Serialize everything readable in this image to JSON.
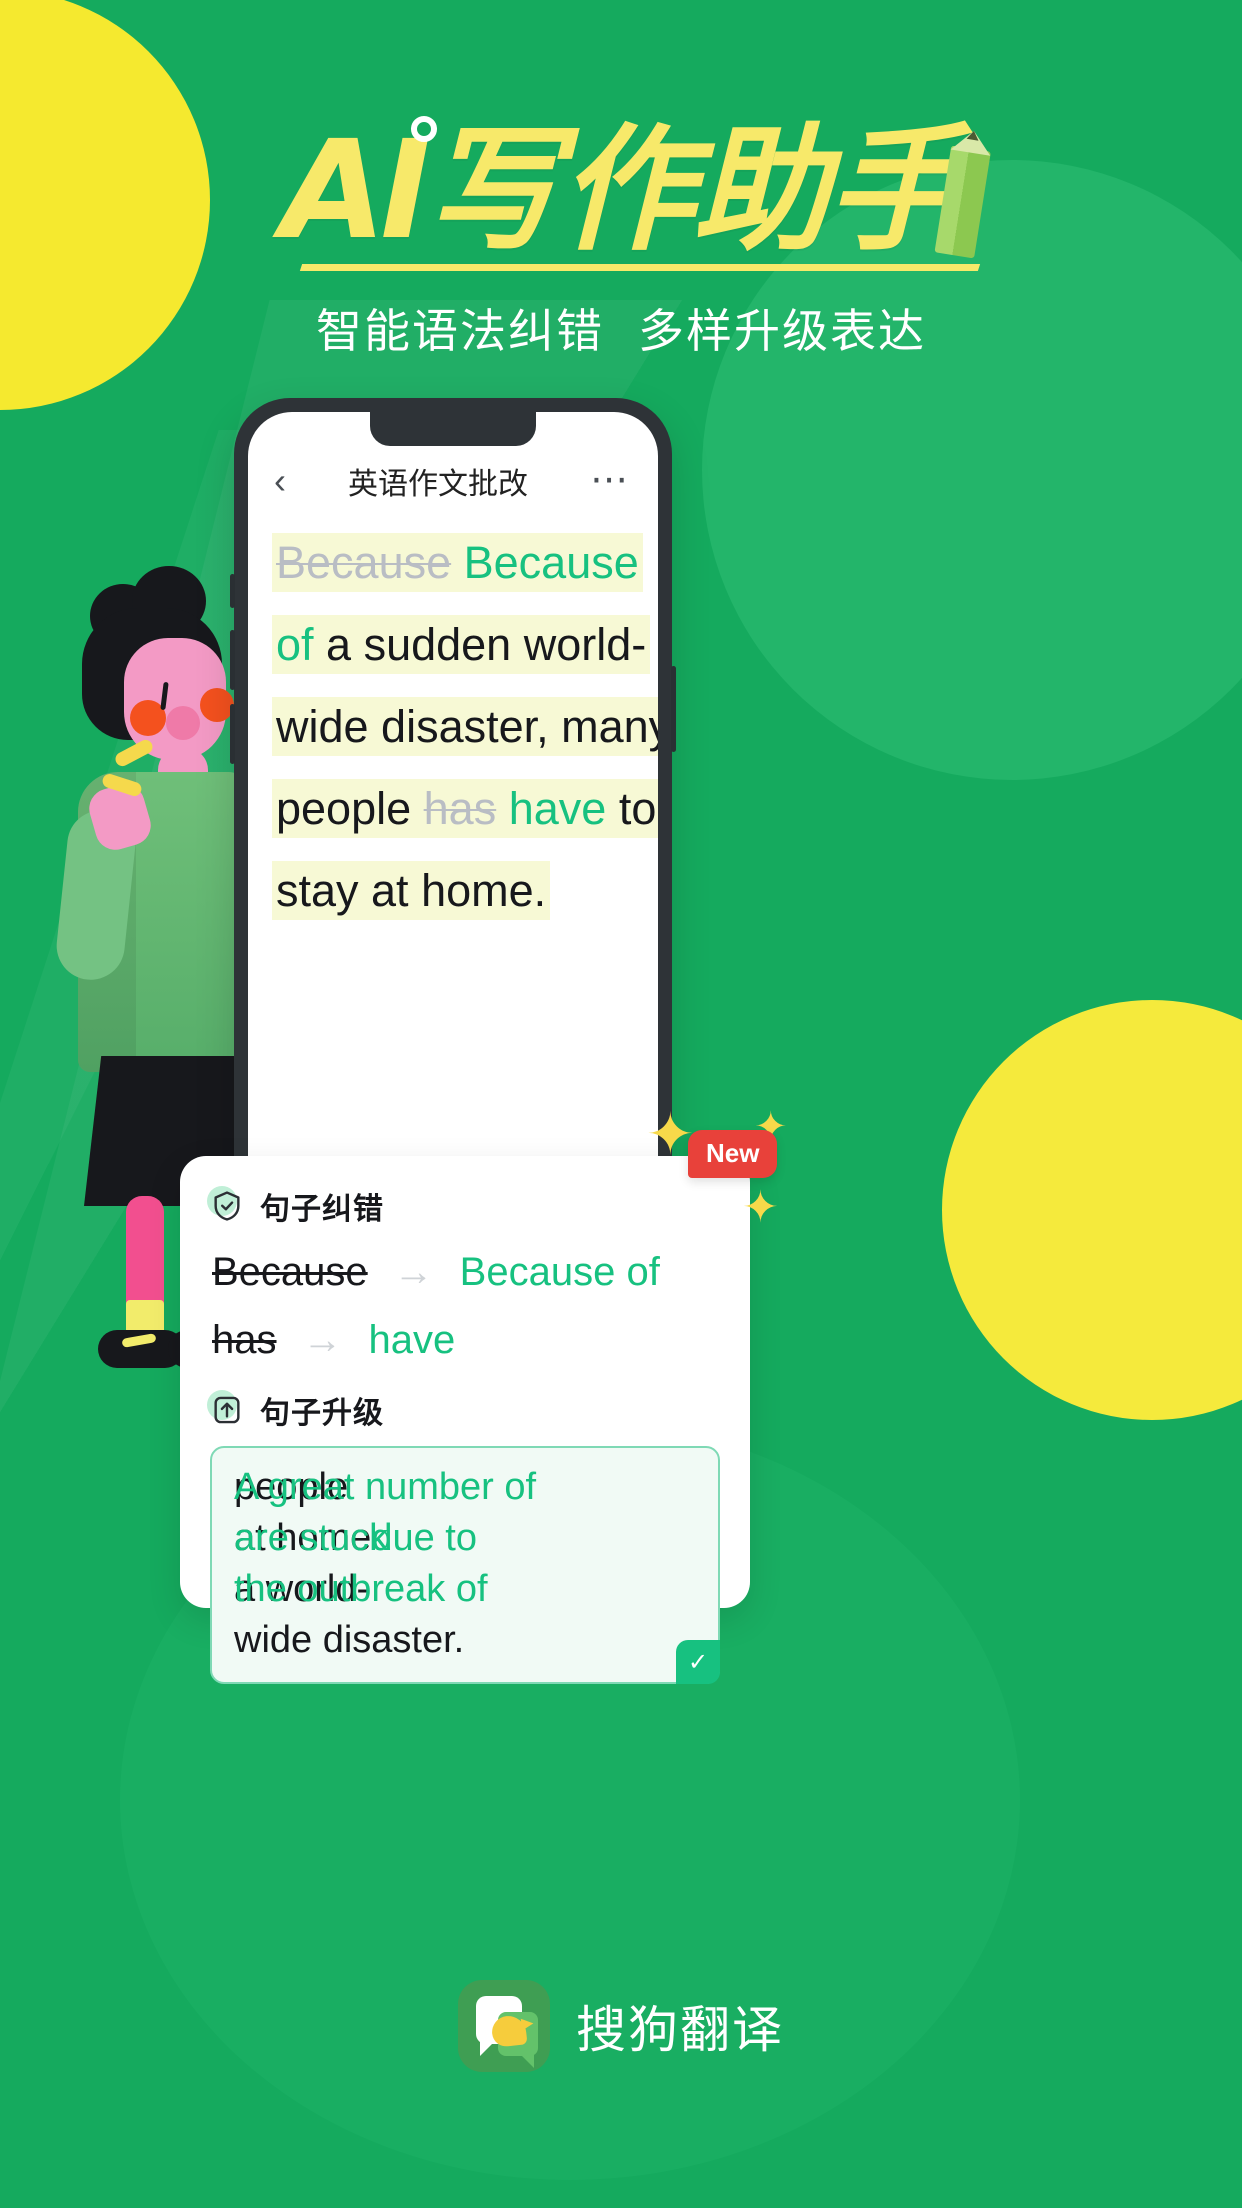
{
  "colors": {
    "bg_green": "#15aa5e",
    "accent_yellow": "#f7e96a",
    "accent_teal": "#17c180",
    "badge_red": "#e8413a",
    "highlight_yellow": "#f7f9d5"
  },
  "header": {
    "title": "AI写作助手",
    "title_en_part": "AI",
    "title_cn_part": "写作助手",
    "subtitle_left": "智能语法纠错",
    "subtitle_right": "多样升级表达",
    "pencil_icon": "pencil-icon"
  },
  "phone": {
    "navbar": {
      "back_icon": "chevron-left-icon",
      "title": "英语作文批改",
      "more_icon": "more-horizontal-icon"
    },
    "essay": {
      "lines": [
        [
          {
            "text": "Because",
            "style": "deleted"
          },
          {
            "text": " ",
            "style": "plain"
          },
          {
            "text": "Because",
            "style": "inserted"
          }
        ],
        [
          {
            "text": "of",
            "style": "inserted"
          },
          {
            "text": " a sudden world-",
            "style": "plain"
          }
        ],
        [
          {
            "text": "wide disaster, many",
            "style": "plain"
          }
        ],
        [
          {
            "text": "people ",
            "style": "plain"
          },
          {
            "text": "has",
            "style": "deleted"
          },
          {
            "text": " ",
            "style": "plain"
          },
          {
            "text": "have",
            "style": "inserted"
          },
          {
            "text": " to",
            "style": "plain"
          }
        ],
        [
          {
            "text": "stay at home.",
            "style": "plain"
          }
        ]
      ]
    }
  },
  "card": {
    "correction": {
      "icon": "shield-check-icon",
      "title": "句子纠错",
      "arrow": "→",
      "rows": [
        {
          "from": "Because",
          "to": "Because of"
        },
        {
          "from": "has",
          "to": "have"
        }
      ]
    },
    "upgrade": {
      "icon": "arrow-up-box-icon",
      "title": "句子升级",
      "check_icon": "check-icon",
      "lines": [
        [
          {
            "text": "A great number of",
            "style": "inserted"
          },
          {
            "text": " people",
            "style": "plain"
          }
        ],
        [
          {
            "text": "are stuck",
            "style": "inserted"
          },
          {
            "text": " at home ",
            "style": "plain"
          },
          {
            "text": "due to",
            "style": "inserted"
          }
        ],
        [
          {
            "text": "the outbreak of",
            "style": "inserted"
          },
          {
            "text": " a world-",
            "style": "plain"
          }
        ],
        [
          {
            "text": "wide disaster.",
            "style": "plain"
          }
        ]
      ]
    }
  },
  "badge": {
    "label": "New",
    "sparkle_icon": "sparkle-icon"
  },
  "footer": {
    "brand_icon": "sogou-translate-app-icon",
    "brand_name": "搜狗翻译"
  }
}
